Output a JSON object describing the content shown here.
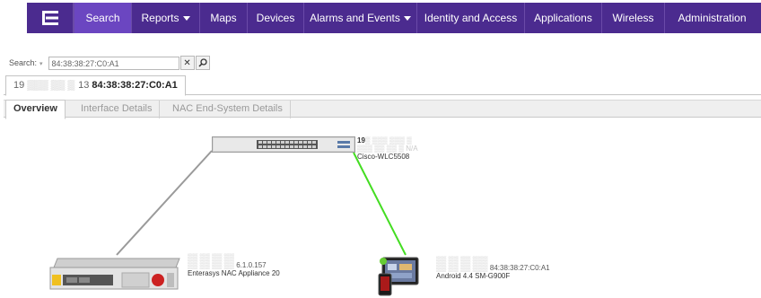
{
  "nav": {
    "items": [
      {
        "label": "Search",
        "active": true
      },
      {
        "label": "Reports",
        "dropdown": true
      },
      {
        "label": "Maps"
      },
      {
        "label": "Devices"
      },
      {
        "label": "Alarms and Events",
        "dropdown": true
      },
      {
        "label": "Identity and Access"
      },
      {
        "label": "Applications"
      },
      {
        "label": "Wireless"
      },
      {
        "label": "Administration"
      }
    ]
  },
  "search": {
    "label": "Search:",
    "value": "84:38:38:27:C0:A1"
  },
  "outer_tab": {
    "ip_prefix": "19",
    "ip_suffix": "13",
    "mac": "84:38:38:27:C0:A1"
  },
  "inner_tabs": [
    {
      "label": "Overview",
      "active": true
    },
    {
      "label": "Interface Details"
    },
    {
      "label": "NAC End-System Details"
    }
  ],
  "devices": {
    "switch": {
      "ip": "19",
      "line2": "N/A",
      "name": "Cisco-WLC5508"
    },
    "nac": {
      "line2": "6.1.0.157",
      "name": "Enterasys NAC Appliance 20"
    },
    "android": {
      "line2": "84:38:38:27:C0:A1",
      "name": "Android 4.4 SM-G900F"
    }
  },
  "colors": {
    "nav_bg": "#4b2b8f",
    "nav_active": "#6b46c1",
    "link_green": "#44dd22",
    "link_gray": "#9a9a9a"
  }
}
